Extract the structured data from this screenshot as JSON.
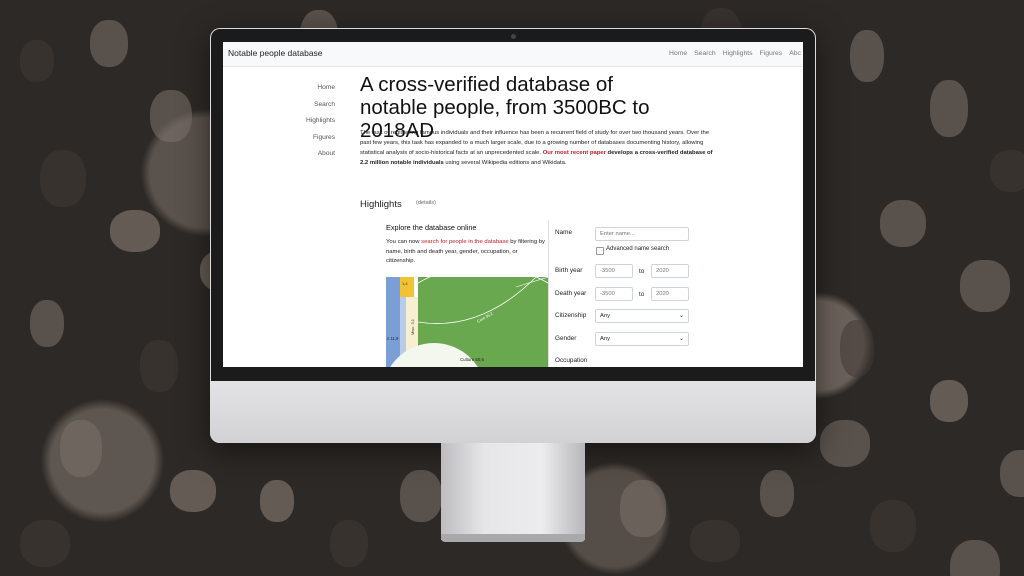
{
  "navbar": {
    "brand": "Notable people database",
    "links": [
      "Home",
      "Search",
      "Highlights",
      "Figures",
      "Abc"
    ]
  },
  "sidenav": [
    "Home",
    "Search",
    "Highlights",
    "Figures",
    "About"
  ],
  "main": {
    "title": "A cross-verified database of notable people, from 3500BC to 2018AD",
    "intro_part1": "The task of registering famous individuals and their influence has been a recurrent field of study for over two thousand years. Over the past few years, this task has expanded to a much larger scale, due to a growing number of databases documenting history, allowing statistical analysis of socio-historical facts at an unprecedented scale. ",
    "intro_link": "Our most recent paper",
    "intro_part2_bold": " develops a cross-verified database of 2.2 million notable individuals",
    "intro_part3": " using several Wikipedia editions and Wikidata.",
    "highlights_heading": "Highlights",
    "details_link": "(details)",
    "explore_title": "Explore the database online",
    "explore_part1": "You can now ",
    "explore_link": "search for people in the database",
    "explore_part2": " by filtering by name, birth and death year, gender, occupation, or citizenship."
  },
  "chart_labels": {
    "culture": "Culture 50,6",
    "core": "Core 35,2",
    "misc": "Misc. 3,1",
    "left": "n 11,9",
    "top_small": "1,4"
  },
  "chart_colors": {
    "culture": "#6aa84f",
    "blue": "#7b9fd4",
    "yellow": "#f1c232",
    "cream": "#f7efcf"
  },
  "form": {
    "name_label": "Name",
    "name_placeholder": "Enter name...",
    "advanced_label": "Advanced name search",
    "birth_label": "Birth year",
    "birth_from": "-3500",
    "birth_to": "2020",
    "death_label": "Death year",
    "death_from": "-3500",
    "death_to": "2020",
    "to_label": "to",
    "citizenship_label": "Citizenship",
    "citizenship_value": "Any",
    "gender_label": "Gender",
    "gender_value": "Any",
    "occupation_label": "Occupation"
  }
}
